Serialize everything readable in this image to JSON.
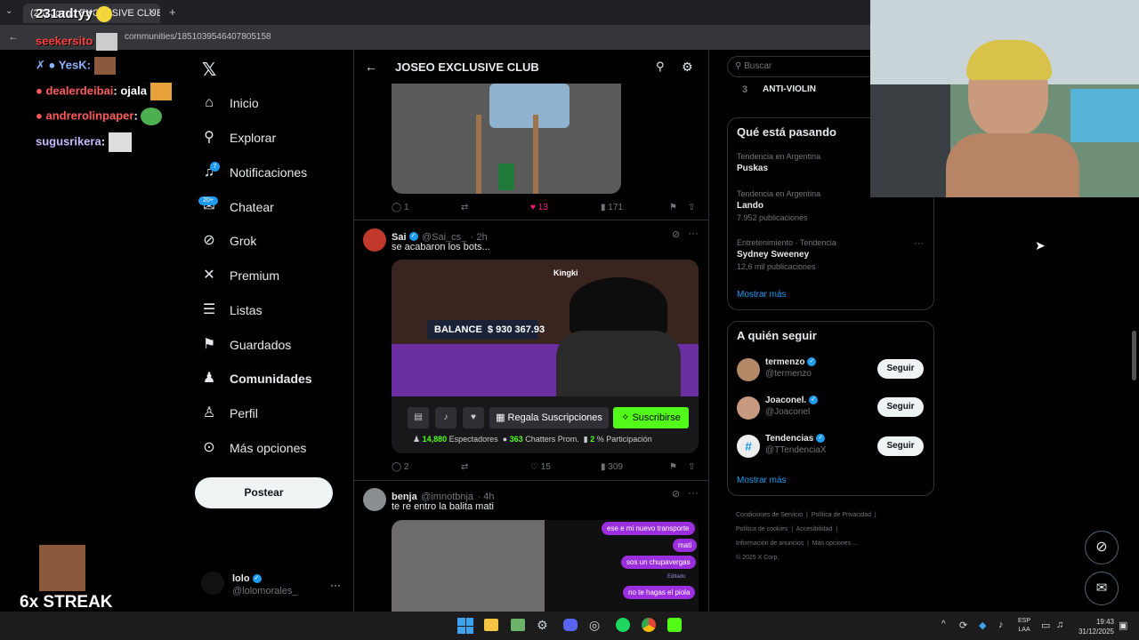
{
  "browser": {
    "tab_title": "(23) Joseo EXCLUSIVE CLUB",
    "url_path": "communities/1851039546407805158"
  },
  "stream_overlay": {
    "chat": [
      {
        "user": "seekersito",
        "color": "#ff3e3e"
      },
      {
        "user": "YesK",
        "color": "#8ab4ff"
      },
      {
        "user": "dealerdeibai",
        "color": "#ff5b5b",
        "message": "ojala"
      },
      {
        "user": "andrerolinpaper",
        "color": "#ff5b5b"
      },
      {
        "user": "sugusrikera",
        "color": "#c9b8ff"
      }
    ],
    "header_text": "231adtyy",
    "streak_text": "6x STREAK"
  },
  "sidebar": {
    "items": [
      {
        "label": "Inicio",
        "icon": "home-icon"
      },
      {
        "label": "Explorar",
        "icon": "search-icon"
      },
      {
        "label": "Notificaciones",
        "icon": "bell-icon",
        "badge": "7"
      },
      {
        "label": "Chatear",
        "icon": "chat-icon",
        "badge": "20+"
      },
      {
        "label": "Grok",
        "icon": "grok-icon"
      },
      {
        "label": "Premium",
        "icon": "x-icon"
      },
      {
        "label": "Listas",
        "icon": "list-icon"
      },
      {
        "label": "Guardados",
        "icon": "bookmark-icon"
      },
      {
        "label": "Comunidades",
        "icon": "people-icon"
      },
      {
        "label": "Perfil",
        "icon": "person-icon"
      },
      {
        "label": "Más opciones",
        "icon": "more-circle-icon"
      }
    ],
    "post_button": "Postear",
    "account": {
      "name": "lolo",
      "handle": "@lolomorales_"
    }
  },
  "timeline": {
    "title": "JOSEO EXCLUSIVE CLUB",
    "posts": [
      {
        "replies": "1",
        "likes": "13",
        "views": "171"
      },
      {
        "name": "Sai",
        "handle": "@Sai_cs_",
        "time": "· 2h",
        "text": "se acabaron los bots...",
        "media": {
          "streamer": "Kingki",
          "balance_label": "BALANCE",
          "balance_value": "$ 930 367.93",
          "gift_btn": "Regala Suscripciones",
          "sub_btn": "Suscribirse",
          "viewers_value": "14,880",
          "viewers_label": "Espectadores",
          "chatters_value": "363",
          "chatters_label": "Chatters Prom.",
          "part_value": "2",
          "part_label": "% Participación"
        },
        "replies": "2",
        "likes": "15",
        "views": "309"
      },
      {
        "name": "benja",
        "handle": "@imnotbnja",
        "time": "· 4h",
        "text": "te re entro la balita mati",
        "chat_bubbles": [
          "ese e mi nuevo transporte",
          "mati",
          "sos un chupavergas",
          "Editado",
          "no te hagas el piola"
        ]
      }
    ]
  },
  "right": {
    "search_placeholder": "Buscar",
    "top_trend": {
      "rank": "3",
      "name": "ANTI-VIOLIN"
    },
    "happening_title": "Qué está pasando",
    "trends": [
      {
        "context": "Tendencia en Argentina",
        "name": "Puskas",
        "count": ""
      },
      {
        "context": "Tendencia en Argentina",
        "name": "Lando",
        "count": "7.952 publicaciones"
      },
      {
        "context": "Entretenimiento · Tendencia",
        "name": "Sydney Sweeney",
        "count": "12,6 mil publicaciones"
      }
    ],
    "show_more": "Mostrar más",
    "follow_title": "A quién seguir",
    "follow": [
      {
        "name": "termenzo",
        "handle": "@termenzo",
        "btn": "Seguir"
      },
      {
        "name": "Joaconel.",
        "handle": "@Joaconel",
        "btn": "Seguir"
      },
      {
        "name": "Tendencias",
        "handle": "@TTendenciaX",
        "btn": "Seguir"
      }
    ],
    "follow_more": "Mostrar más",
    "footer": [
      "Condiciones de Servicio",
      "Política de Privacidad",
      "Política de cookies",
      "Accesibilidad",
      "Información de anuncios",
      "Más opciones ...",
      "© 2025 X Corp."
    ]
  },
  "taskbar": {
    "lang": "ESP",
    "lang2": "LAA",
    "time": "19:43",
    "date": "31/12/2025"
  }
}
